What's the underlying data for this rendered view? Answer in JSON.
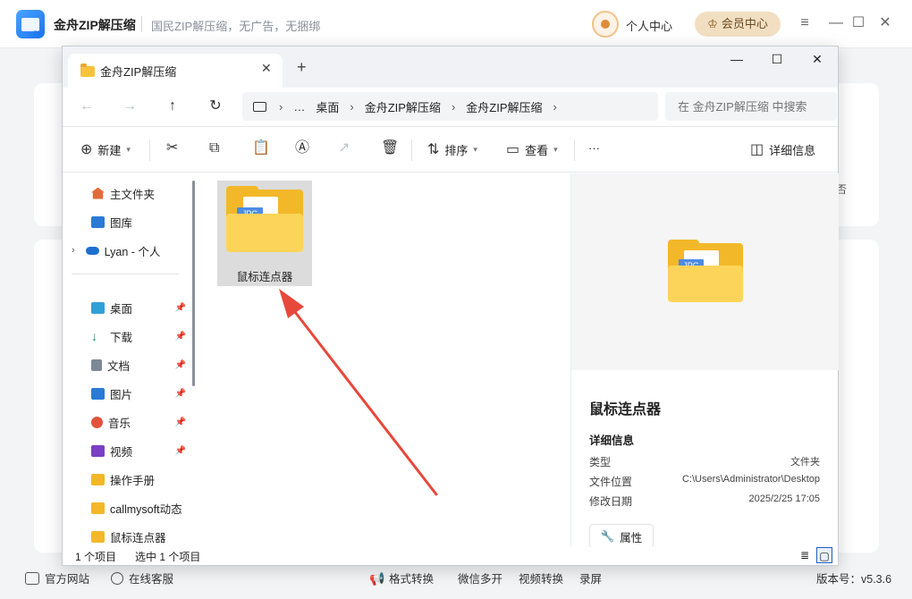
{
  "app": {
    "title": "金舟ZIP解压缩",
    "slogan": "国民ZIP解压缩，无广告，无捆绑",
    "logo_text": "ZIP",
    "user_center": "个人中心",
    "vip_center": "会员中心",
    "controls": [
      "≡",
      "—",
      "☐",
      "✕"
    ],
    "card_hint": "否",
    "bottom": {
      "official_site": "官方网站",
      "online_service": "在线客服",
      "tools": [
        "格式转换",
        "微信多开",
        "视频转换",
        "录屏"
      ],
      "version": "版本号：v5.3.6"
    }
  },
  "explorer": {
    "tab_title": "金舟ZIP解压缩",
    "new_tab": "+",
    "close": "✕",
    "window_controls": [
      "—",
      "☐",
      "✕"
    ],
    "nav": {
      "back": "←",
      "forward": "→",
      "up": "↑",
      "refresh": "↻"
    },
    "breadcrumb": [
      "…",
      "桌面",
      "金舟ZIP解压缩",
      "金舟ZIP解压缩"
    ],
    "search_placeholder": "在 金舟ZIP解压缩 中搜索",
    "commands": {
      "new": "新建",
      "sort": "排序",
      "view": "查看",
      "more": "···",
      "details": "详细信息"
    },
    "sidebar": {
      "top": [
        "主文件夹",
        "图库",
        "Lyan - 个人"
      ],
      "pinned": [
        "桌面",
        "下载",
        "文档",
        "图片",
        "音乐",
        "视频"
      ],
      "folders": [
        "操作手册",
        "callmysoft动态",
        "鼠标连点器"
      ]
    },
    "files": [
      {
        "name": "鼠标连点器",
        "badge": "JPG"
      }
    ],
    "preview": {
      "name": "鼠标连点器",
      "section": "详细信息",
      "rows": [
        {
          "label": "类型",
          "value": "文件夹"
        },
        {
          "label": "文件位置",
          "value": "C:\\Users\\Administrator\\Desktop"
        },
        {
          "label": "修改日期",
          "value": "2025/2/25 17:05"
        }
      ],
      "properties": "属性"
    },
    "status": {
      "count": "1 个项目",
      "selected": "选中 1 个项目"
    }
  },
  "colors": {
    "arrow": "#e8483c",
    "folder": "#f3b829",
    "accent": "#1b74f0"
  }
}
